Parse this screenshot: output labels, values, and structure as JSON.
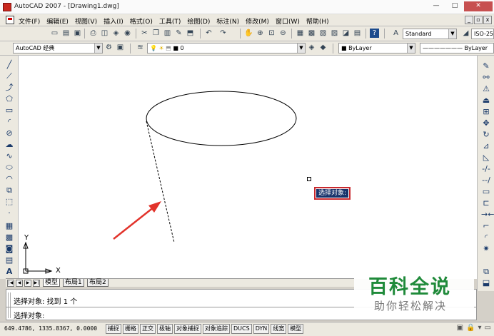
{
  "window": {
    "title": "AutoCAD 2007 - [Drawing1.dwg]",
    "buttons": [
      "—",
      "□",
      "✕"
    ]
  },
  "menu": {
    "items": [
      "文件(F)",
      "编辑(E)",
      "视图(V)",
      "插入(I)",
      "格式(O)",
      "工具(T)",
      "绘图(D)",
      "标注(N)",
      "修改(M)",
      "窗口(W)",
      "帮助(H)"
    ],
    "mdi_buttons": [
      "_",
      "▫",
      "x"
    ]
  },
  "toolbar": {
    "text_style": "Standard",
    "dim_style": "ISO-25",
    "workspace": "AutoCAD 经典",
    "layer": "0",
    "color": "ByLayer",
    "linetype": "ByLayer"
  },
  "drawing": {
    "prompt": "选择对象:",
    "ucs_x": "X",
    "ucs_y": "Y"
  },
  "tabs": [
    "模型",
    "布局1",
    "布局2"
  ],
  "command": {
    "history": "选择对象: 找到 1 个",
    "current": "选择对象:"
  },
  "status": {
    "coords": "649.4786, 1335.8367, 0.0000",
    "toggles": [
      "捕捉",
      "栅格",
      "正交",
      "极轴",
      "对象捕捉",
      "对象追踪",
      "DUCS",
      "DYN",
      "线宽",
      "模型"
    ]
  },
  "watermark": {
    "title": "百科全说",
    "subtitle": "助你轻松解决"
  },
  "colors": {
    "accent_red": "#c8282d",
    "prompt_bg": "#17336b",
    "watermark_green": "#1f8a3a"
  },
  "icons": {
    "left_tools": [
      "line-icon",
      "xline-icon",
      "polyline-icon",
      "polygon-icon",
      "rectangle-icon",
      "arc-icon",
      "circle-icon",
      "revcloud-icon",
      "spline-icon",
      "ellipse-icon",
      "ellipse-arc-icon",
      "insert-block-icon",
      "make-block-icon",
      "point-icon",
      "hatch-icon",
      "gradient-icon",
      "region-icon",
      "table-icon",
      "mtext-icon"
    ],
    "right_tools": [
      "erase-icon",
      "copy-icon",
      "mirror-icon",
      "offset-icon",
      "array-icon",
      "move-icon",
      "rotate-icon",
      "scale-icon",
      "stretch-icon",
      "trim-icon",
      "extend-icon",
      "break-point-icon",
      "break-icon",
      "join-icon",
      "chamfer-icon",
      "fillet-icon",
      "explode-icon"
    ]
  }
}
